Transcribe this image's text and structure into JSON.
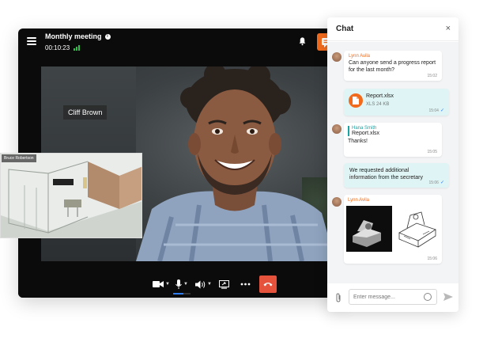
{
  "call": {
    "title": "Monthly meeting",
    "info_icon": "info-icon",
    "timer": "00:10:23",
    "active_speaker": "Cliff Brown",
    "pip_participant": "Bruce Robertson",
    "accent_color": "#f26b1d",
    "end_call_color": "#e5533d",
    "icons": [
      "menu-icon",
      "bell-icon",
      "chat-icon",
      "camera-icon",
      "microphone-icon",
      "speaker-icon",
      "screen-share-icon",
      "more-icon",
      "end-call-icon"
    ]
  },
  "chat": {
    "title": "Chat",
    "close": "×",
    "input_placeholder": "Enter message...",
    "messages": [
      {
        "sender": "Lynn Avila",
        "text": "Can anyone send a progress report for the last month?",
        "time": "15:02"
      },
      {
        "file_name": "Report.xlsx",
        "file_meta": "XLS 24 KB",
        "time": "15:04"
      },
      {
        "sender": "Hana Smith",
        "quoted": "Report.xlsx",
        "text": "Thanks!",
        "time": "15:05"
      },
      {
        "text": "We requested additional information from the secretary",
        "time": "15:06"
      },
      {
        "sender": "Lynn Avila",
        "time": "15:06"
      }
    ]
  }
}
